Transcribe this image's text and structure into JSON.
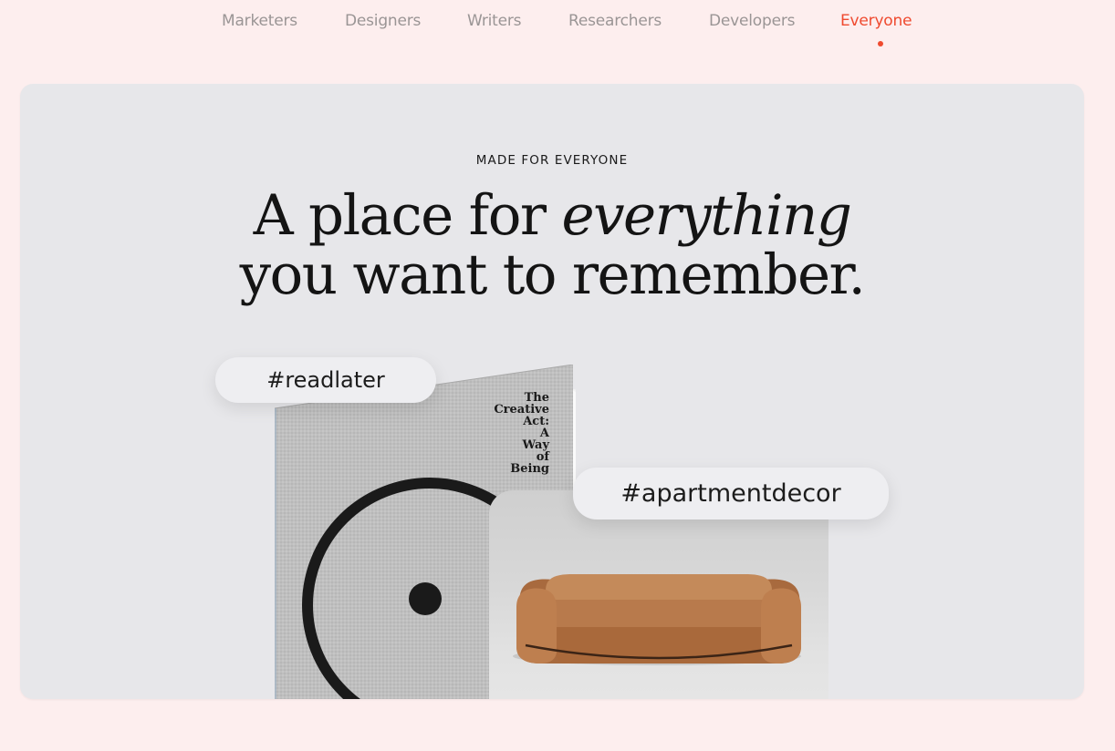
{
  "tabs": [
    {
      "label": "Marketers",
      "active": false
    },
    {
      "label": "Designers",
      "active": false
    },
    {
      "label": "Writers",
      "active": false
    },
    {
      "label": "Researchers",
      "active": false
    },
    {
      "label": "Developers",
      "active": false
    },
    {
      "label": "Everyone",
      "active": true
    }
  ],
  "hero": {
    "eyebrow": "MADE FOR EVERYONE",
    "headline_part1": "A place for ",
    "headline_emphasis": "everything",
    "headline_part2": "you want to remember."
  },
  "book": {
    "title_lines": [
      "The",
      "Creative",
      "Act:",
      "A",
      "Way",
      "of",
      "Being"
    ]
  },
  "tags": {
    "tag1": "#readlater",
    "tag2": "#apartmentdecor"
  },
  "colors": {
    "page_bg": "#fdeeee",
    "card_bg": "#e7e7ea",
    "accent": "#ef4a2f",
    "tab_inactive": "#9a9595",
    "sofa": "#b87a4c"
  }
}
